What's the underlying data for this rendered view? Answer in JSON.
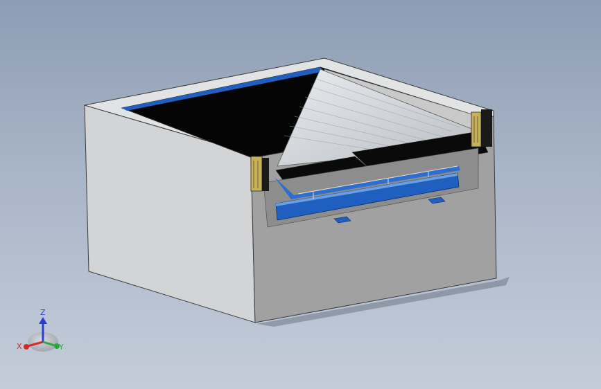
{
  "viewport": {
    "background_top": "#8e9db4",
    "background_bottom": "#c4ccd9"
  },
  "model": {
    "concrete_color": "#cfd0d2",
    "pit_color": "#9b9b9b",
    "deck_color": "#000000",
    "frame_color": "#1f5fbf",
    "bumper_color": "#c7b15a"
  },
  "triad": {
    "x_label": "X",
    "y_label": "Y",
    "z_label": "Z",
    "x_color": "#d22a2a",
    "y_color": "#2aa83a",
    "z_color": "#2a3fd2"
  }
}
